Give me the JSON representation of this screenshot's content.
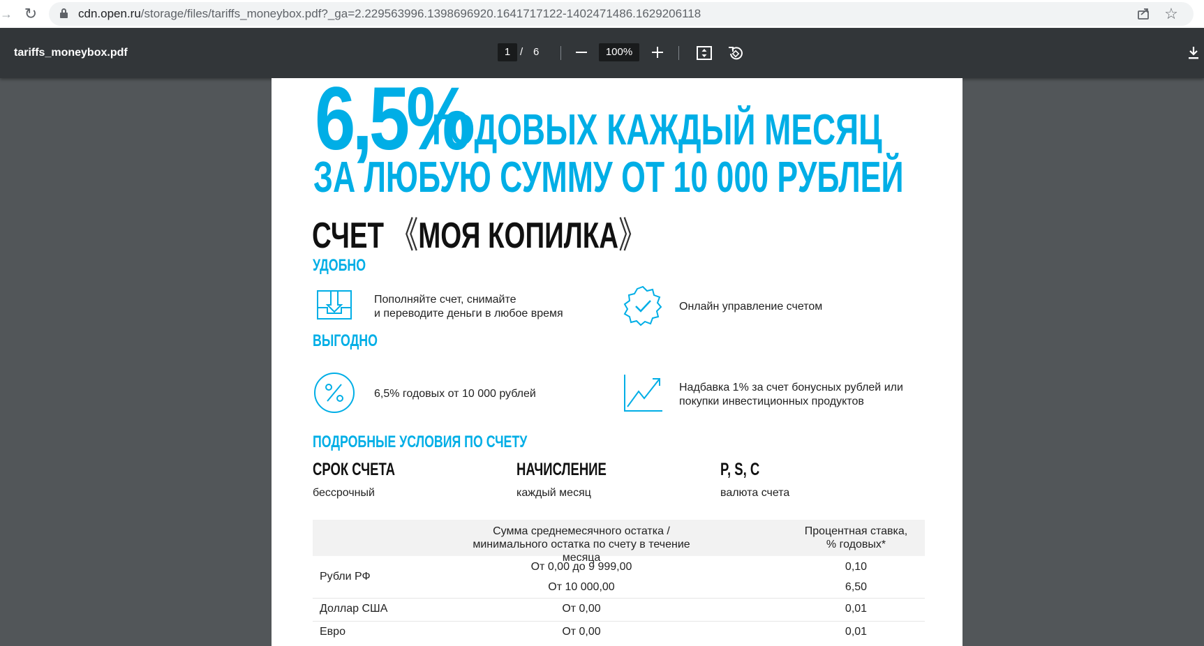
{
  "browser": {
    "url_host": "cdn.open.ru",
    "url_path": "/storage/files/tariffs_moneybox.pdf?_ga=2.229563996.1398696920.1641717122-1402471486.1629206118"
  },
  "viewer": {
    "filename": "tariffs_moneybox.pdf",
    "current_page": "1",
    "page_separator": "/",
    "total_pages": "6",
    "zoom": "100%"
  },
  "document": {
    "headline_rate": "6,5%",
    "headline_line1": "ГОДОВЫХ КАЖДЫЙ МЕСЯЦ",
    "headline_line2": "ЗА ЛЮБУЮ СУММУ ОТ 10 000 РУБЛЕЙ",
    "account_prefix": "СЧЕТ",
    "account_quote_open": "《",
    "account_name": "МОЯ КОПИЛКА",
    "account_quote_close": "》",
    "section_convenient": "УДОБНО",
    "feature_topup_line1": "Пополняйте счет, снимайте",
    "feature_topup_line2": "и переводите деньги в любое время",
    "feature_online": "Онлайн управление счетом",
    "section_profitable": "ВЫГОДНО",
    "feature_rate": "6,5% годовых от 10 000 рублей",
    "feature_bonus_line1": "Надбавка 1% за счет бонусных рублей или",
    "feature_bonus_line2": "покупки инвестиционных продуктов",
    "section_details": "ПОДРОБНЫЕ УСЛОВИЯ ПО СЧЕТУ",
    "terms": [
      {
        "title": "СРОК СЧЕТА",
        "value": "бессрочный"
      },
      {
        "title": "НАЧИСЛЕНИЕ",
        "value": "каждый месяц"
      },
      {
        "title": "P, S, C",
        "value": "валюта счета"
      }
    ],
    "rates_table": {
      "header_amount_line1": "Сумма среднемесячного остатка /",
      "header_amount_line2": "минимального остатка по счету в течение месяца",
      "header_rate_line1": "Процентная ставка,",
      "header_rate_line2": "% годовых*",
      "rows": [
        {
          "currency": "Рубли РФ",
          "amount": "От 0,00 до 9 999,00",
          "rate": "0,10",
          "amount2": "От 10 000,00",
          "rate2": "6,50"
        },
        {
          "currency": "Доллар США",
          "amount": "От 0,00",
          "rate": "0,01"
        },
        {
          "currency": "Евро",
          "amount": "От 0,00",
          "rate": "0,01"
        }
      ]
    }
  },
  "colors": {
    "brand": "#00aee6",
    "toolbar": "#323639",
    "viewer_bg": "#525659"
  },
  "icons": {
    "reload": "reload-icon",
    "lock": "lock-icon",
    "share": "share-icon",
    "star": "star-icon",
    "fit": "fit-to-page-icon",
    "rotate": "rotate-icon",
    "download": "download-icon"
  }
}
